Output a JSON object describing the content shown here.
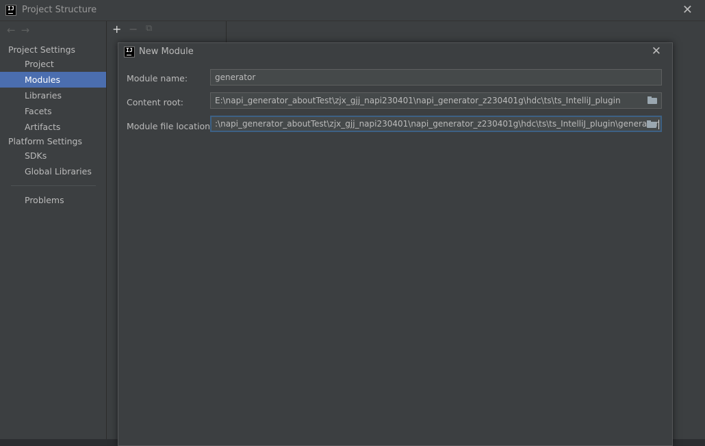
{
  "window": {
    "title": "Project Structure",
    "close_glyph": "✕"
  },
  "nav": {
    "back_glyph": "←",
    "forward_glyph": "→"
  },
  "sidebar": {
    "project_settings_header": "Project Settings",
    "project_items": [
      {
        "label": "Project"
      },
      {
        "label": "Modules",
        "selected": true
      },
      {
        "label": "Libraries"
      },
      {
        "label": "Facets"
      },
      {
        "label": "Artifacts"
      }
    ],
    "platform_settings_header": "Platform Settings",
    "platform_items": [
      {
        "label": "SDKs"
      },
      {
        "label": "Global Libraries"
      }
    ],
    "problems_label": "Problems"
  },
  "toolbar": {
    "add_glyph": "+",
    "remove_glyph": "−",
    "copy_glyph": "⧉"
  },
  "dialog": {
    "title": "New Module",
    "close_glyph": "✕",
    "module_name": {
      "label": "Module name:",
      "value": "generator"
    },
    "content_root": {
      "label": "Content root:",
      "value": "E:\\napi_generator_aboutTest\\zjx_gjj_napi230401\\napi_generator_z230401g\\hdc\\ts\\ts_IntelliJ_plugin"
    },
    "module_file_location": {
      "label": "Module file location:",
      "value": ":\\napi_generator_aboutTest\\zjx_gjj_napi230401\\napi_generator_z230401g\\hdc\\ts\\ts_IntelliJ_plugin\\generator"
    }
  },
  "colors": {
    "selection": "#4b6eaf",
    "focus_border": "#3d6185",
    "panel_bg": "#3c3f41",
    "field_bg": "#45494a"
  }
}
